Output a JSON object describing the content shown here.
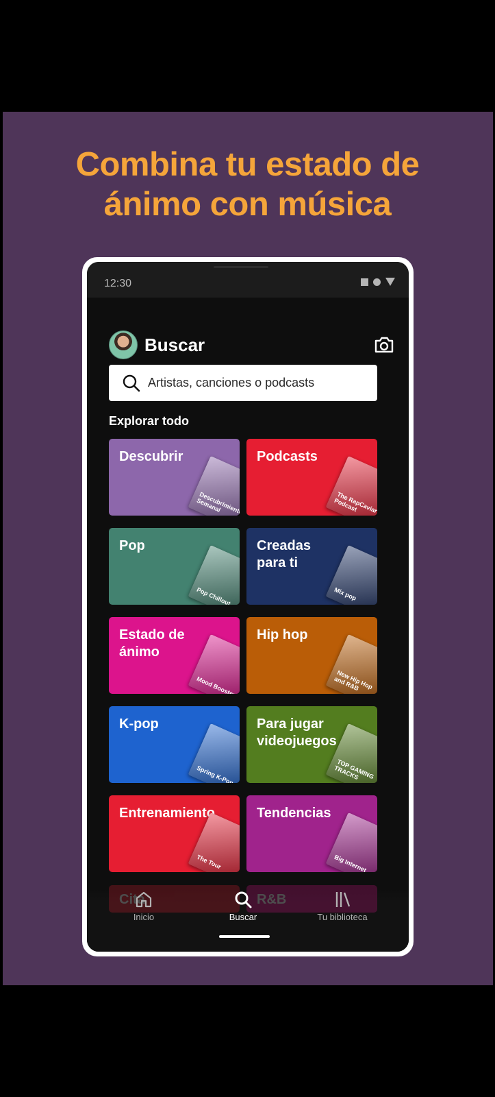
{
  "promo": {
    "headline_line1": "Combina tu estado de",
    "headline_line2": "ánimo con música"
  },
  "status_bar": {
    "time": "12:30"
  },
  "header": {
    "title": "Buscar"
  },
  "search": {
    "placeholder": "Artistas, canciones o podcasts"
  },
  "browse": {
    "section_title": "Explorar todo",
    "tiles": [
      {
        "label": "Descubrir",
        "color": "#8d67ab",
        "art_text": "Descubrimiento Semanal"
      },
      {
        "label": "Podcasts",
        "color": "#e61e32",
        "art_text": "The RapCaviar Podcast"
      },
      {
        "label": "Pop",
        "color": "#438270",
        "art_text": "Pop Chillout"
      },
      {
        "label": "Creadas para ti",
        "color": "#1e3264",
        "art_text": "Mix pop"
      },
      {
        "label": "Estado de ánimo",
        "color": "#dc148c",
        "art_text": "Mood Booster"
      },
      {
        "label": "Hip hop",
        "color": "#ba5d07",
        "art_text": "New Hip Hop and R&B"
      },
      {
        "label": "K-pop",
        "color": "#1e63cf",
        "art_text": "Spring K-Pop"
      },
      {
        "label": "Para jugar videojuegos",
        "color": "#537d1f",
        "art_text": "TOP GAMING TRACKS"
      },
      {
        "label": "Entrenamiento",
        "color": "#e61e32",
        "art_text": "The Tour"
      },
      {
        "label": "Tendencias",
        "color": "#a0238c",
        "art_text": "Big Internet"
      }
    ],
    "peek_tiles": [
      "Cita",
      "R&B"
    ]
  },
  "bottom_nav": {
    "items": [
      {
        "label": "Inicio",
        "icon": "home-icon"
      },
      {
        "label": "Buscar",
        "icon": "search-icon"
      },
      {
        "label": "Tu biblioteca",
        "icon": "library-icon"
      }
    ],
    "active": "Buscar"
  },
  "colors": {
    "promo_background": "#4f3559",
    "headline": "#f5a53a",
    "app_background": "#0e0e0e"
  }
}
